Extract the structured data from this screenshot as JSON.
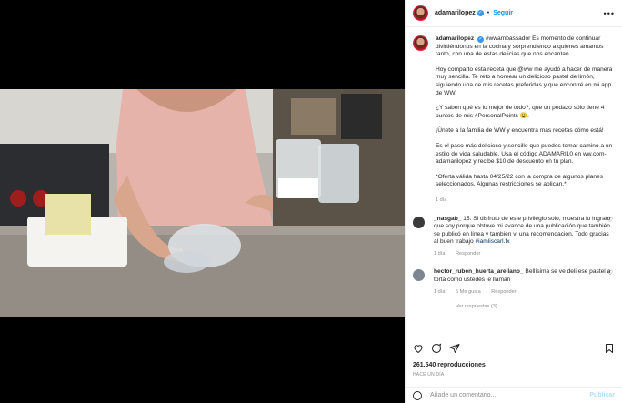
{
  "header": {
    "username": "adamarilopez",
    "follow": "Seguir",
    "dot": "•",
    "more": "•••"
  },
  "caption": {
    "username": "adamarilopez",
    "p1": "#wwambassador Es momento de continuar divirtiéndonos en la cocina y sorprendiendo a quienes amamos tanto, con una de estas delicias que nos encantan.",
    "p2": "Hoy comparto esta receta que @ww me ayudó a hacer de manera muy sencilla. Te reto a hornear un delicioso pastel de limón, siguiendo una de mis recetas preferidas y que encontré en mi app de WW.",
    "p3": "¿Y saben qué es lo mejor de todo?, que un pedazo sólo tiene 4 puntos de mis #PersonalPoints 😮.",
    "p4": "¡Únete a la familia de WW y encuentra más recetas cómo está!",
    "p5": "Es el paso más delicioso y sencillo que puedes tomar camino a un estilo de vida saludable. Usa el código ADAMARI10 en ww.com-adamarilopez y recibe $10 de descuento en tu plan.",
    "p6": "*Oferta válida hasta 04/25/22 con la compra de algunos planes seleccionados. Algunas restricciones se aplican.*",
    "time": "1 día"
  },
  "comments": [
    {
      "user": "_nasgab_",
      "text": "15. Si disfruto de este privilegio solo, muestra lo ingrato que soy porque obtuve mi avance de una publicación que también se publicó en línea y también vi una recomendación. Todo gracias al buen trabajo",
      "tag": "#iamliscarl.fx",
      "time": "1 día",
      "reply": "Responder"
    },
    {
      "user": "hector_ruben_huerta_arellano_",
      "text": "Bellísima se ve deli ese pastel a torta cómo ustedes le llaman",
      "time": "1 día",
      "likes": "5 Me gusta",
      "reply": "Responder",
      "view_replies": "Ver respuestas (3)"
    }
  ],
  "stats": {
    "views": "261.540 reproducciones",
    "ago": "HACE UN DÍA"
  },
  "add_comment": {
    "placeholder": "Añade un comentario...",
    "publish": "Publicar"
  },
  "colors": {
    "link": "#0095f6",
    "tag": "#00376b",
    "muted": "#8e8e8e"
  }
}
